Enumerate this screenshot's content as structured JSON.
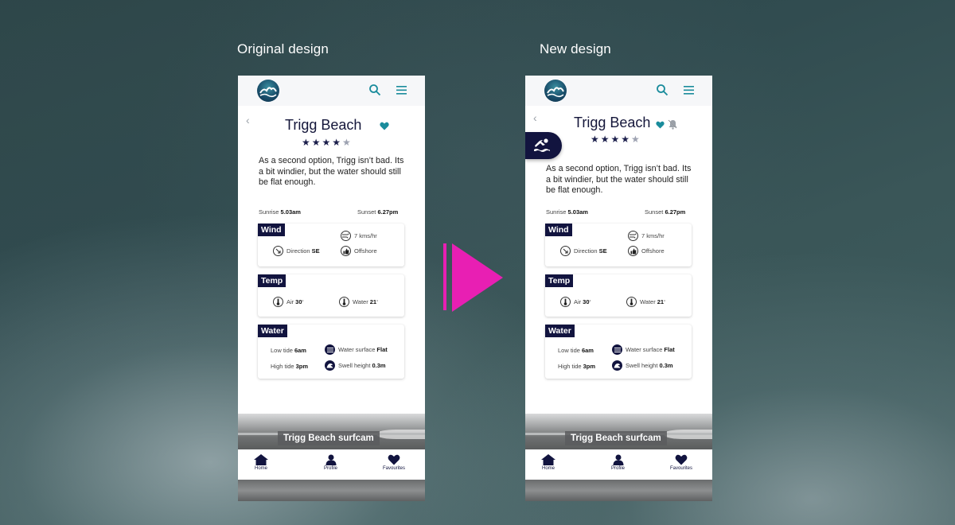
{
  "captions": {
    "original": "Original design",
    "new": "New design"
  },
  "colors": {
    "navy": "#12143f",
    "teal": "#1a8c9c",
    "accent": "#e81fb3"
  },
  "phones": [
    {
      "id": "original",
      "beach_name": "Trigg Beach",
      "rating": 4,
      "rating_max": 5,
      "description": "As a second option, Trigg isn’t bad. Its a bit windier, but the water should still be flat enough.",
      "sunrise_label": "Sunrise",
      "sunrise_value": "5.03am",
      "sunset_label": "Sunset",
      "sunset_value": "6.27pm",
      "wind": {
        "title": "Wind",
        "speed": "7 kms/hr",
        "direction_label": "Direction",
        "direction_value": "SE",
        "offshore": "Offshore"
      },
      "temp": {
        "title": "Temp",
        "air_label": "Air",
        "air_value": "30",
        "water_label": "Water",
        "water_value": "21",
        "unit": "°"
      },
      "water": {
        "title": "Water",
        "low_tide_label": "Low tide",
        "low_tide_value": "6am",
        "high_tide_label": "High tide",
        "high_tide_value": "3pm",
        "surface_label": "Water surface",
        "surface_value": "Flat",
        "swell_label": "Swell height",
        "swell_value": "0.3m"
      },
      "surfcam": "Trigg Beach surfcam",
      "nav": {
        "home": "Home",
        "profile": "Profile",
        "favourites": "Favourites"
      }
    },
    {
      "id": "new",
      "beach_name": "Trigg Beach",
      "rating": 4,
      "rating_max": 5,
      "description": "As a second option, Trigg isn’t bad. Its a bit windier, but the water should still be flat enough.",
      "sunrise_label": "Sunrise",
      "sunrise_value": "5.03am",
      "sunset_label": "Sunset",
      "sunset_value": "6.27pm",
      "wind": {
        "title": "Wind",
        "speed": "7 kms/hr",
        "direction_label": "Direction",
        "direction_value": "SE",
        "offshore": "Offshore"
      },
      "temp": {
        "title": "Temp",
        "air_label": "Air",
        "air_value": "30",
        "water_label": "Water",
        "water_value": "21",
        "unit": "°"
      },
      "water": {
        "title": "Water",
        "low_tide_label": "Low tide",
        "low_tide_value": "6am",
        "high_tide_label": "High tide",
        "high_tide_value": "3pm",
        "surface_label": "Water surface",
        "surface_value": "Flat",
        "swell_label": "Swell height",
        "swell_value": "0.3m"
      },
      "surfcam": "Trigg Beach surfcam",
      "nav": {
        "home": "Home",
        "profile": "Profile",
        "favourites": "Favourites"
      }
    }
  ]
}
